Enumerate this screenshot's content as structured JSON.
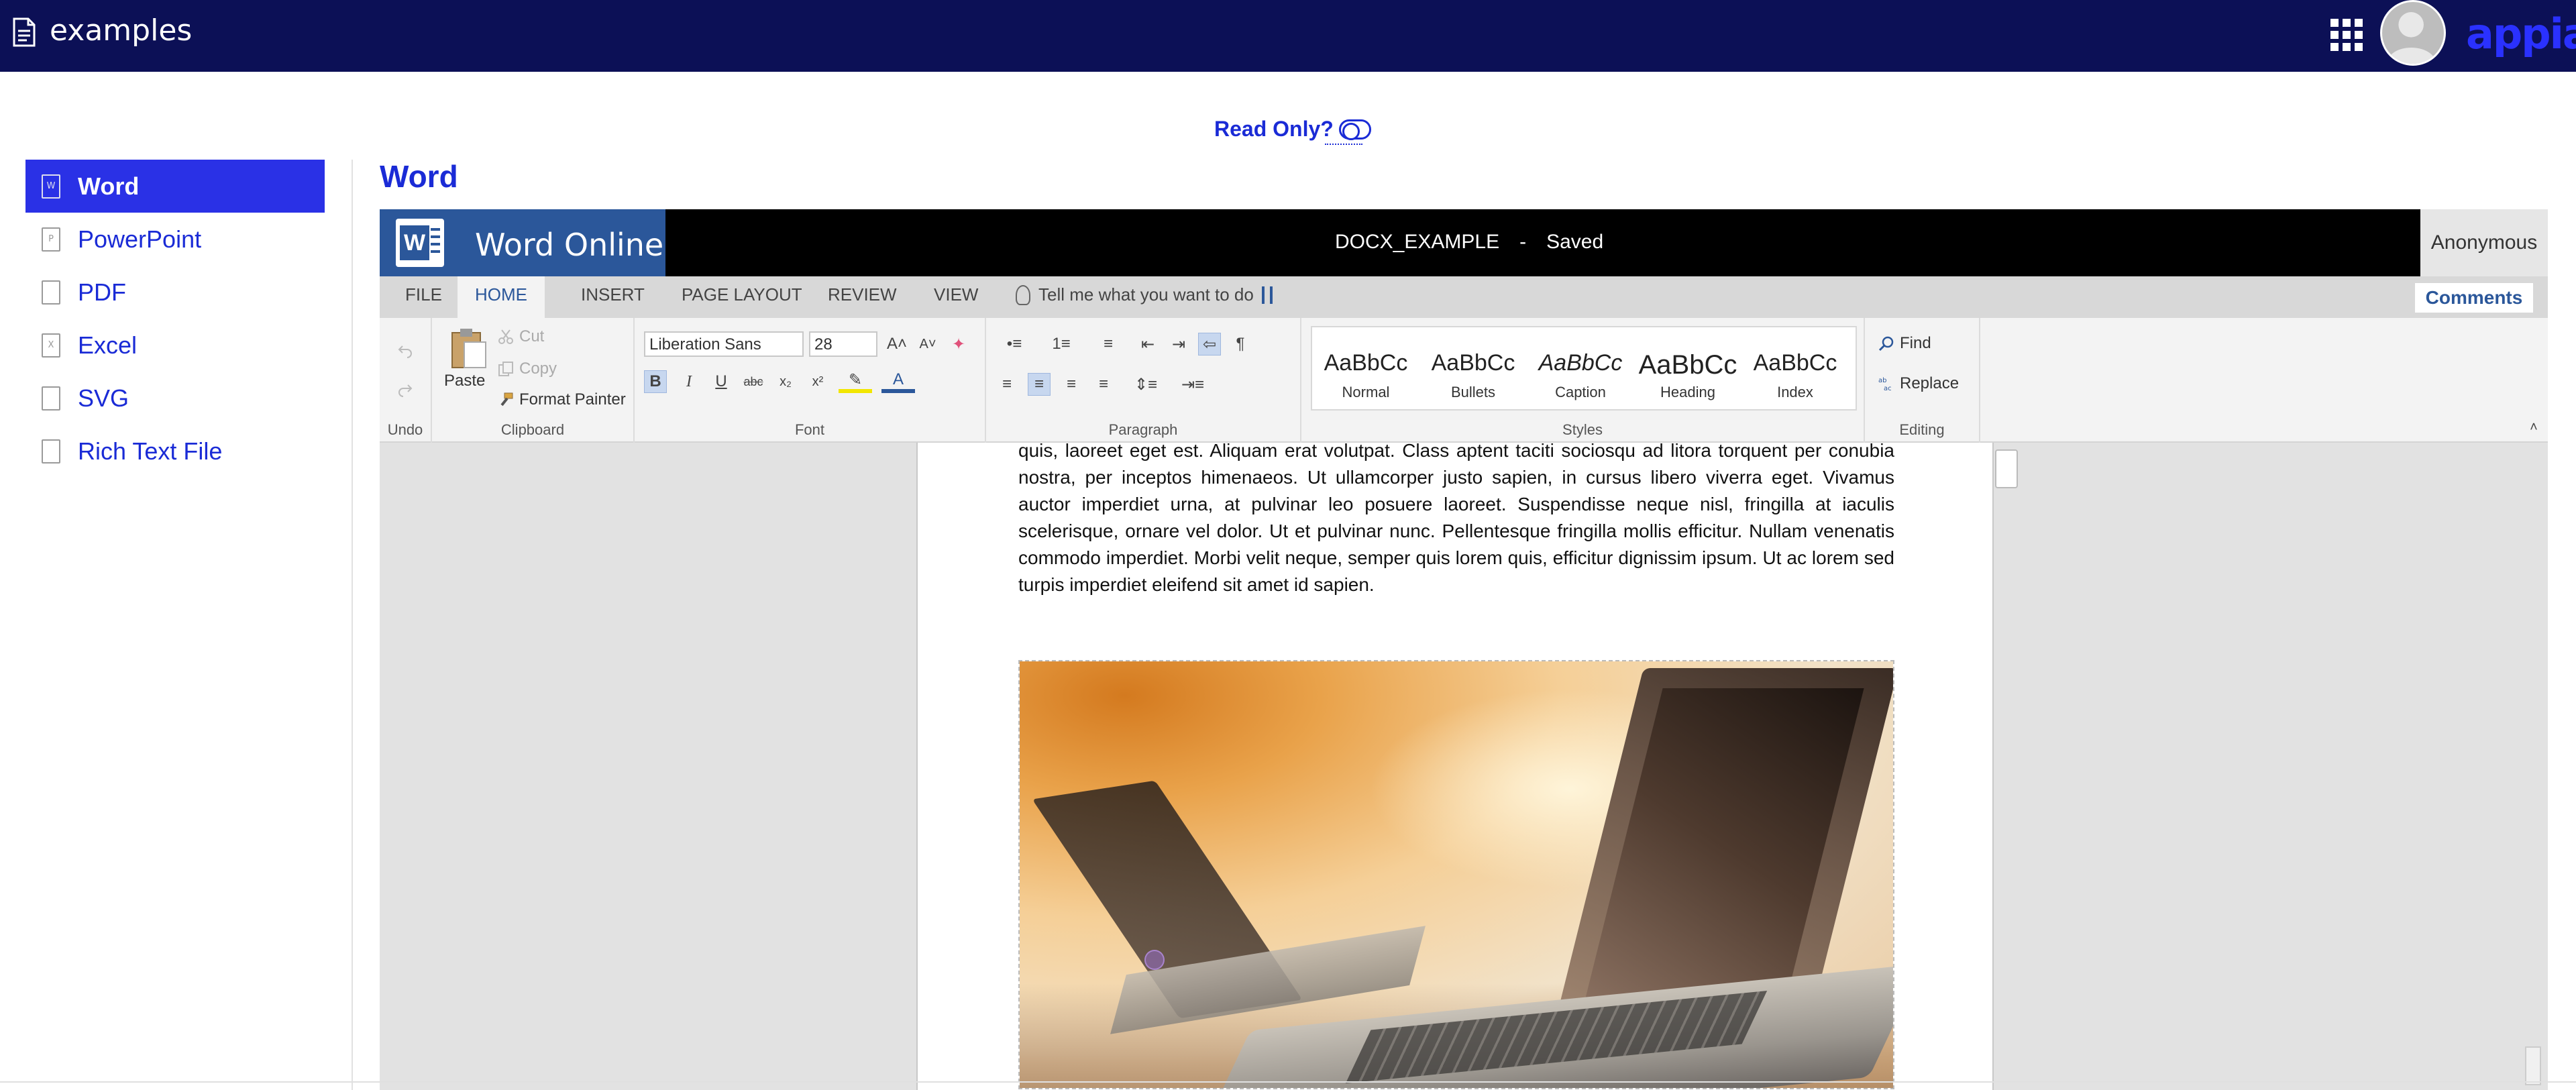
{
  "app": {
    "title": "examples",
    "brand": "appian"
  },
  "read_only": {
    "label": "Read Only?"
  },
  "sidebar": {
    "items": [
      {
        "label": "Word",
        "icon": "word-file-icon",
        "glyph": "W",
        "active": true
      },
      {
        "label": "PowerPoint",
        "icon": "powerpoint-file-icon",
        "glyph": "P",
        "active": false
      },
      {
        "label": "PDF",
        "icon": "pdf-file-icon",
        "glyph": "",
        "active": false
      },
      {
        "label": "Excel",
        "icon": "excel-file-icon",
        "glyph": "X",
        "active": false
      },
      {
        "label": "SVG",
        "icon": "image-file-icon",
        "glyph": "",
        "active": false
      },
      {
        "label": "Rich Text File",
        "icon": "text-file-icon",
        "glyph": "",
        "active": false
      }
    ]
  },
  "main": {
    "title": "Word"
  },
  "word_online": {
    "brand": "Word Online",
    "doc_name": "DOCX_EXAMPLE",
    "separator": "-",
    "status": "Saved",
    "user": "Anonymous",
    "tabs": [
      "FILE",
      "HOME",
      "INSERT",
      "PAGE LAYOUT",
      "REVIEW",
      "VIEW"
    ],
    "active_tab": "HOME",
    "tell_me": "Tell me what you want to do",
    "comments": "Comments",
    "ribbon": {
      "groups": {
        "undo": "Undo",
        "clipboard": "Clipboard",
        "font": "Font",
        "paragraph": "Paragraph",
        "styles": "Styles",
        "editing": "Editing"
      },
      "paste": "Paste",
      "cut": "Cut",
      "copy": "Copy",
      "format_painter": "Format Painter",
      "font_name": "Liberation Sans",
      "font_size": "28",
      "styles": [
        {
          "sample": "AaBbCc",
          "name": "Normal"
        },
        {
          "sample": "AaBbCc",
          "name": "Bullets"
        },
        {
          "sample": "AaBbCc",
          "name": "Caption"
        },
        {
          "sample": "AaBbCc",
          "name": "Heading"
        },
        {
          "sample": "AaBbCc",
          "name": "Index"
        }
      ],
      "find": "Find",
      "replace": "Replace"
    },
    "document": {
      "paragraph": "quis, laoreet eget est. Aliquam erat volutpat. Class aptent taciti sociosqu ad litora torquent per conubia nostra, per inceptos himenaeos. Ut ullamcorper justo sapien, in cursus libero viverra eget. Vivamus auctor imperdiet urna, at pulvinar leo posuere laoreet. Suspendisse neque nisl, fringilla at iaculis scelerisque, ornare vel dolor. Ut et pulvinar nunc. Pellentesque fringilla mollis efficitur. Nullam venenatis commodo imperdiet. Morbi velit neque, semper quis lorem quis, efficitur dignissim ipsum. Ut ac lorem sed turpis imperdiet eleifend sit amet id sapien."
    }
  },
  "colors": {
    "appbar": "#0c1056",
    "accent": "#2a31e6",
    "word_blue": "#2b579a"
  }
}
